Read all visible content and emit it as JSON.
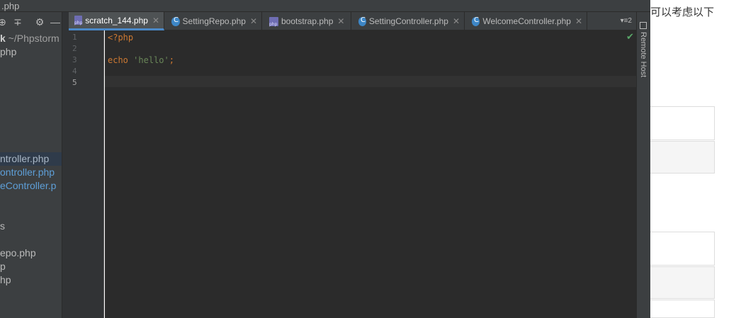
{
  "window": {
    "title": ".php"
  },
  "project_panel": {
    "toolbar_icons": [
      "settings-sync-icon",
      "collapse-icon",
      "gear-icon",
      "minimize-icon"
    ],
    "tree": [
      {
        "bold": "k",
        "rest": " ~/Phpstorm"
      },
      {
        "text": "php"
      },
      {
        "text": "ntroller.php"
      },
      {
        "text": "ontroller.php"
      },
      {
        "text": "eController.p"
      },
      {
        "text": "s"
      },
      {
        "text": "epo.php"
      },
      {
        "text": "p"
      },
      {
        "text": "hp"
      }
    ]
  },
  "tabs": [
    {
      "label": "scratch_144.php",
      "icon": "php-file-icon",
      "active": true
    },
    {
      "label": "SettingRepo.php",
      "icon": "class-icon",
      "active": false
    },
    {
      "label": "bootstrap.php",
      "icon": "php-file-icon",
      "active": false
    },
    {
      "label": "SettingController.php",
      "icon": "class-icon",
      "active": false
    },
    {
      "label": "WelcomeController.php",
      "icon": "class-icon",
      "active": false
    }
  ],
  "tab_overflow": "▾≡2",
  "editor": {
    "line_numbers": [
      "1",
      "2",
      "3",
      "4",
      "5"
    ],
    "current_line": "5",
    "code": {
      "open_tag": "<?php",
      "echo_kw": "echo",
      "string": "'hello'",
      "semicolon": ";"
    },
    "status_icon": "checkmark-icon"
  },
  "right_strip": {
    "label": "Remote Host"
  },
  "background_page": {
    "text": "可以考虑以下"
  },
  "colors": {
    "panel_bg": "#3c3f41",
    "editor_bg": "#2b2b2b",
    "keyword": "#cc7832",
    "string": "#6a8759",
    "link_blue": "#5e9fd8",
    "accent": "#4a88c7"
  }
}
